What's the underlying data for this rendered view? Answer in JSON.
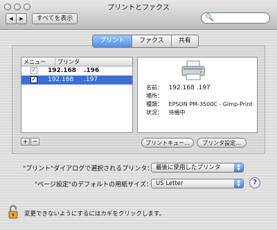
{
  "window": {
    "title": "プリントとファクス"
  },
  "toolbar": {
    "show_all_label": "すべてを表示",
    "back_glyph": "◀",
    "forward_glyph": "▶",
    "search_placeholder": ""
  },
  "tabs": [
    {
      "label": "プリント",
      "active": true
    },
    {
      "label": "ファクス",
      "active": false
    },
    {
      "label": "共有",
      "active": false
    }
  ],
  "printer_list": {
    "headers": [
      "メニュー",
      "プリンタ"
    ],
    "rows": [
      {
        "checked": true,
        "name_a": "192.168",
        "name_b": ".196",
        "selected": false
      },
      {
        "checked": true,
        "name_a": "192.168",
        "name_b": ".197",
        "selected": true
      }
    ]
  },
  "printer_info": {
    "fields": [
      {
        "label": "名前：",
        "value": "192.168    .197"
      },
      {
        "label": "場所：",
        "value": ""
      },
      {
        "label": "種類：",
        "value": "EPSON PM-3500C - Gimp-Print"
      },
      {
        "label": "状況：",
        "value": "待機中"
      }
    ]
  },
  "buttons": {
    "add": "+",
    "remove": "−",
    "print_queue": "プリントキュー...",
    "printer_setup": "プリンタ設定..."
  },
  "settings": {
    "selected_printer_label": "\"プリント\"ダイアログで選択されるプリンタ：",
    "selected_printer_value": "最後に使用したプリンタ",
    "paper_size_label": "\"ページ設定\"のデフォルトの用紙サイズ：",
    "paper_size_value": "US Letter"
  },
  "lock": {
    "text": "変更できないようにするにはカギをクリックします。"
  },
  "icons": [
    "back-icon",
    "forward-icon",
    "search-icon",
    "printer-icon",
    "lock-icon",
    "help-icon",
    "popup-arrow-icon"
  ],
  "colors": {
    "selection": "#3b6fd5",
    "tab_active": "#4e8fe8"
  }
}
